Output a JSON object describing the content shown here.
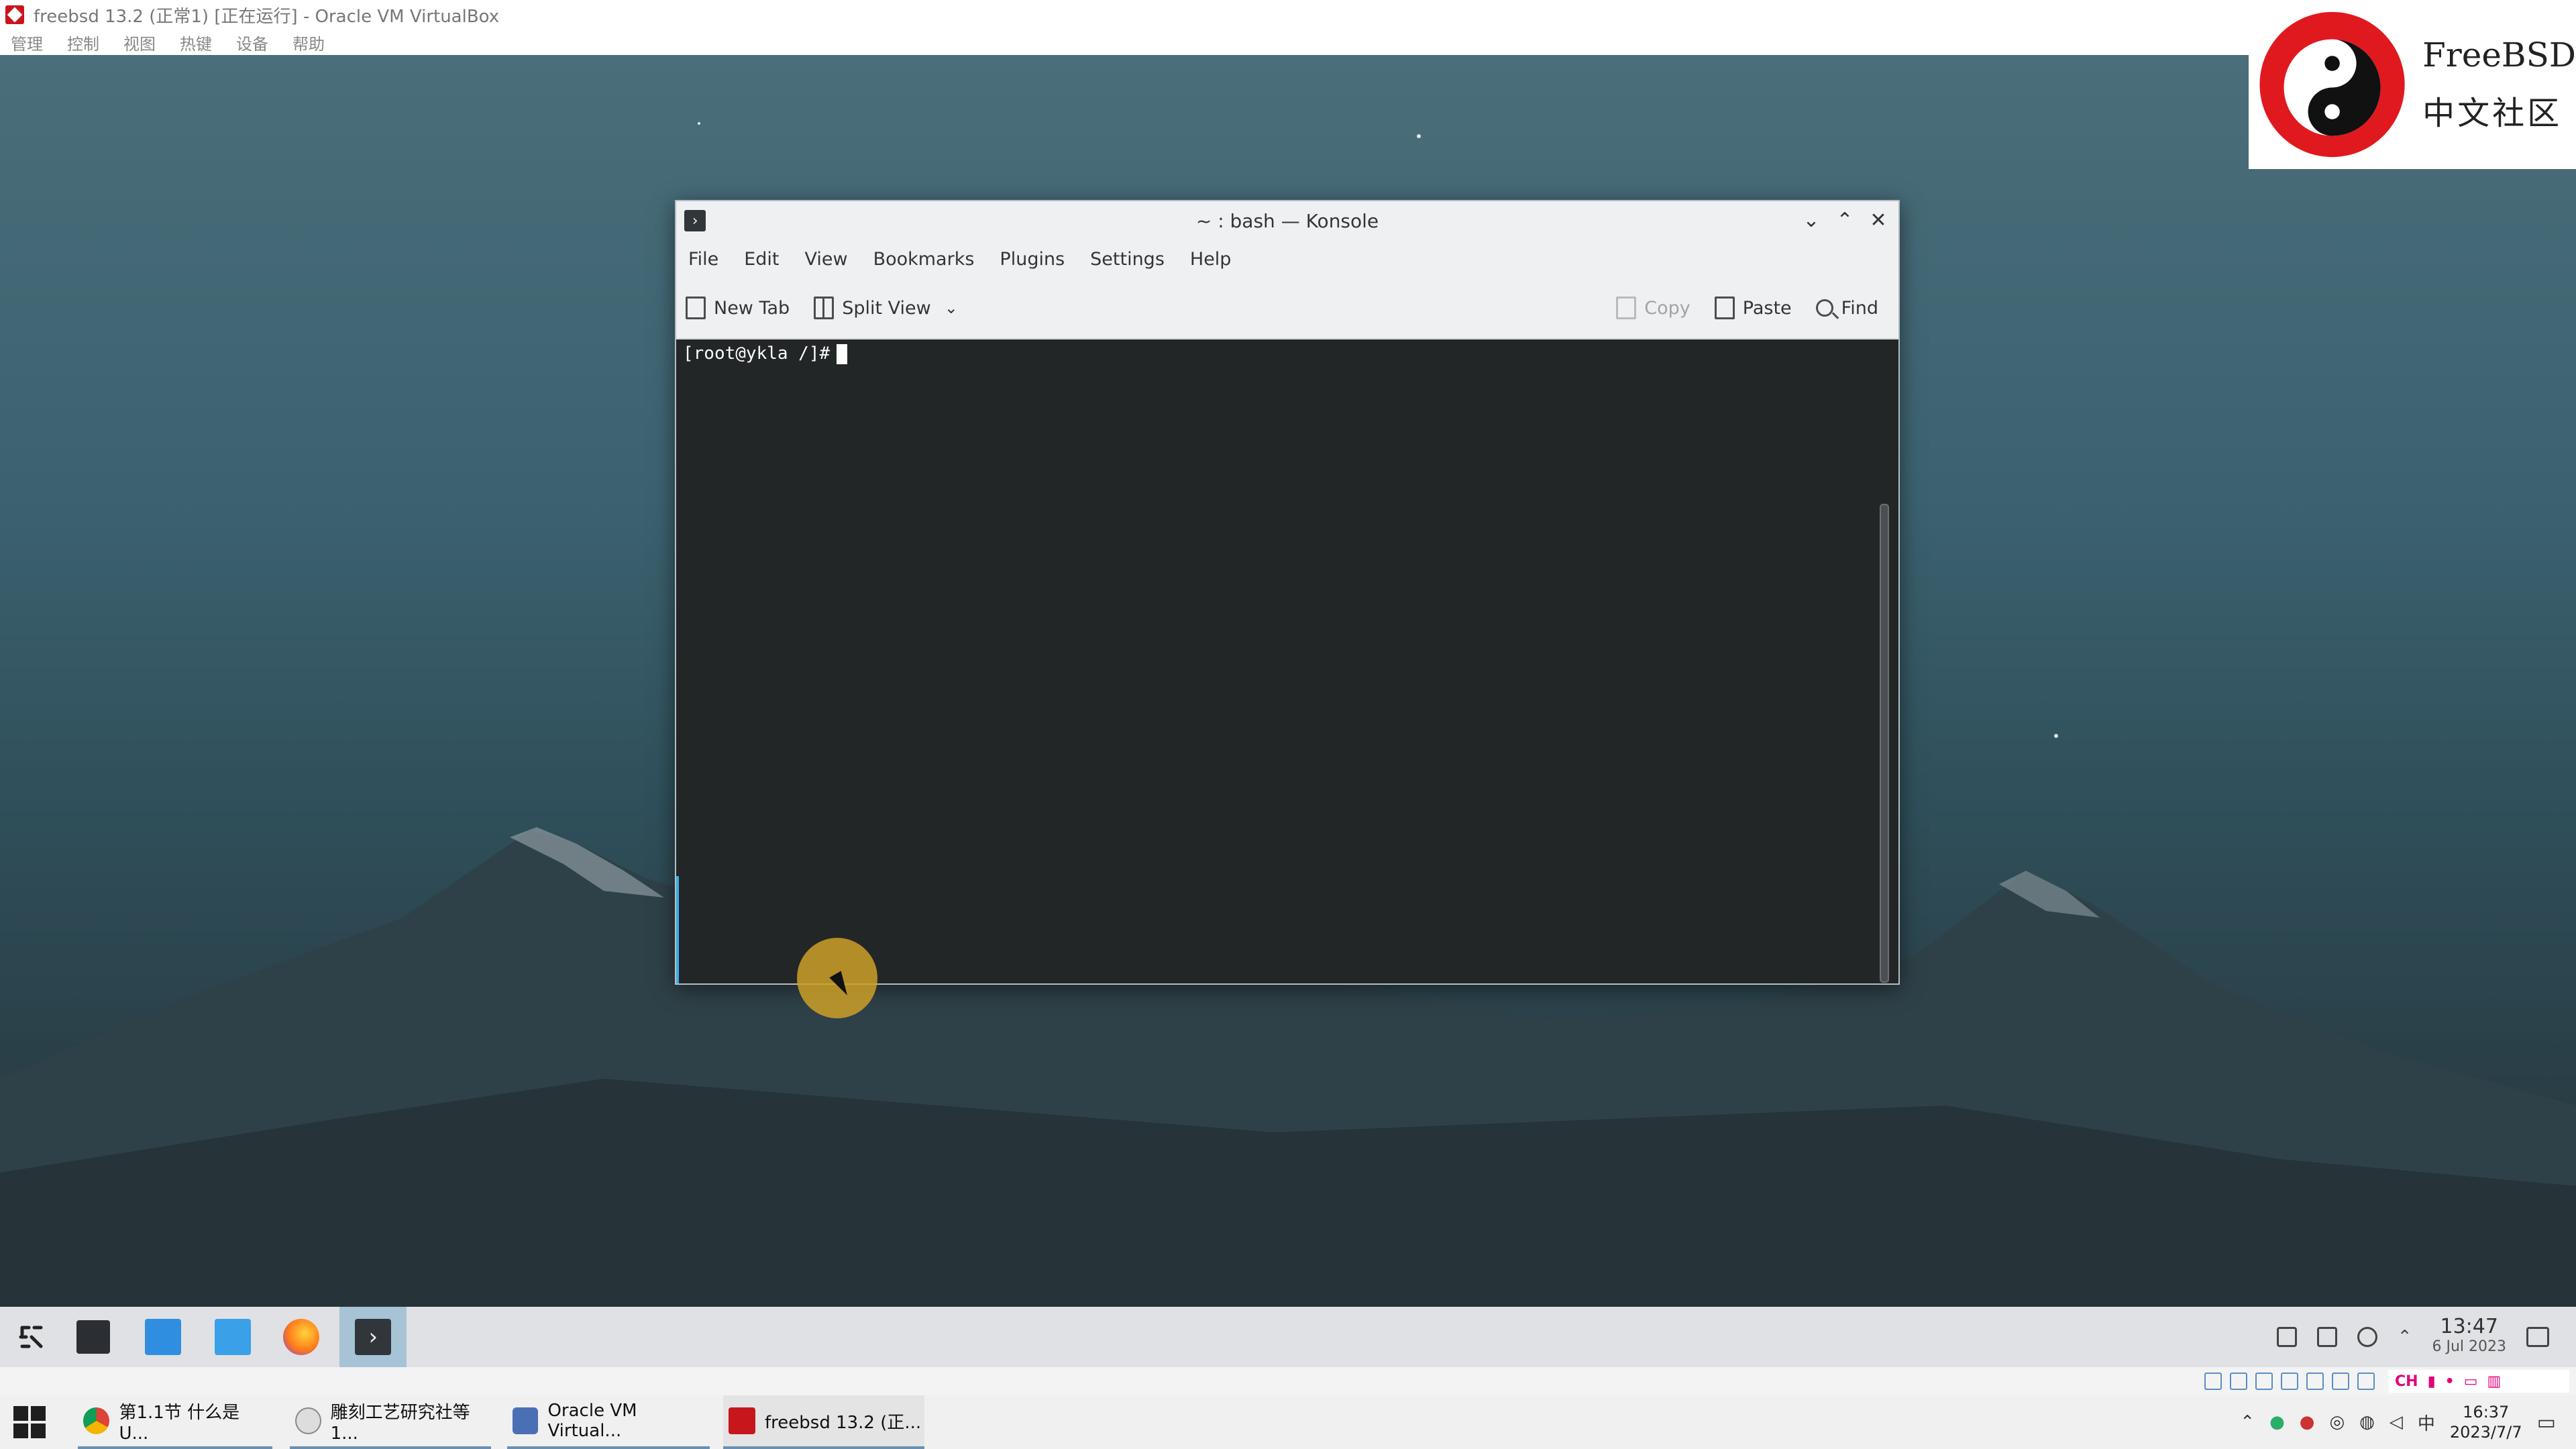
{
  "vbox": {
    "title": "freebsd 13.2 (正常1) [正在运行] - Oracle VM VirtualBox",
    "menu": [
      "管理",
      "控制",
      "视图",
      "热键",
      "设备",
      "帮助"
    ]
  },
  "watermark": {
    "line1": "FreeBSD",
    "line2": "中文社区"
  },
  "konsole": {
    "title": "~ : bash — Konsole",
    "menu": [
      "File",
      "Edit",
      "View",
      "Bookmarks",
      "Plugins",
      "Settings",
      "Help"
    ],
    "toolbar": {
      "new_tab": "New Tab",
      "split_view": "Split View",
      "copy": "Copy",
      "paste": "Paste",
      "find": "Find"
    },
    "prompt": "[root@ykla /]#"
  },
  "panel": {
    "clock_time": "13:47",
    "clock_date": "6 Jul 2023"
  },
  "ime": {
    "lang": "CH"
  },
  "taskbar": {
    "items": [
      {
        "label": "第1.1节 什么是 U..."
      },
      {
        "label": "雕刻工艺研究社等1..."
      },
      {
        "label": "Oracle VM Virtual..."
      },
      {
        "label": "freebsd 13.2 (正..."
      }
    ],
    "input_lang": "中",
    "time": "16:37",
    "date": "2023/7/7"
  },
  "colors": {
    "terminal_bg": "#232627",
    "window_bg": "#eff0f1",
    "accent": "#3daee9"
  }
}
